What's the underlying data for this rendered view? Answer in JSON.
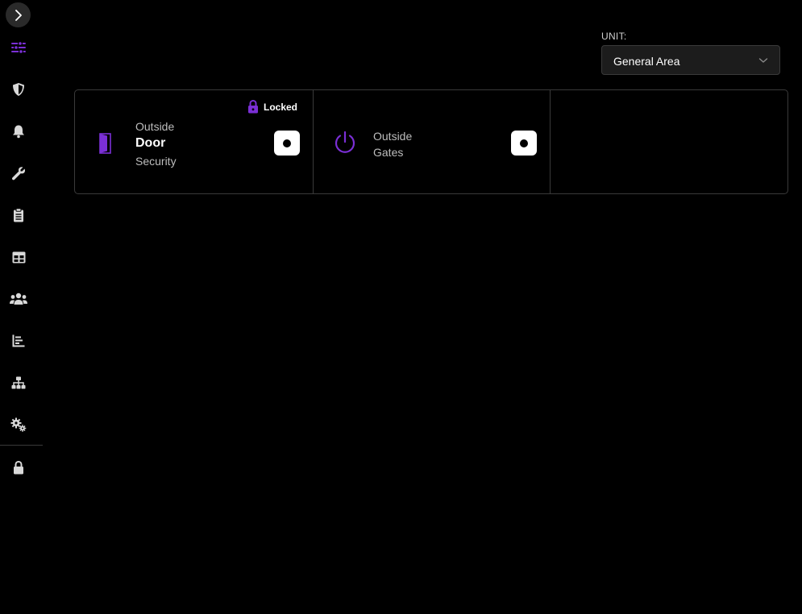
{
  "colors": {
    "accent": "#7b2fd6",
    "background": "#000000",
    "icon": "#d9d9d9",
    "border": "#3a3a3a"
  },
  "sidebar": {
    "expand_icon": "chevron-right-icon",
    "items": [
      {
        "id": "controls",
        "icon": "sliders-icon",
        "active": true
      },
      {
        "id": "security",
        "icon": "shield-icon",
        "active": false
      },
      {
        "id": "alerts",
        "icon": "bell-icon",
        "active": false
      },
      {
        "id": "maintenance",
        "icon": "wrench-icon",
        "active": false
      },
      {
        "id": "clipboard",
        "icon": "clipboard-icon",
        "active": false
      },
      {
        "id": "table",
        "icon": "table-icon",
        "active": false
      },
      {
        "id": "users",
        "icon": "users-icon",
        "active": false
      },
      {
        "id": "reports",
        "icon": "bar-chart-icon",
        "active": false
      },
      {
        "id": "network",
        "icon": "network-icon",
        "active": false
      },
      {
        "id": "settings",
        "icon": "gears-icon",
        "active": false
      },
      {
        "id": "lock",
        "icon": "lock-icon",
        "active": false
      }
    ]
  },
  "unit": {
    "label": "UNIT:",
    "selected": "General Area"
  },
  "cards": [
    {
      "icon": "door-icon",
      "lines": [
        "Outside",
        "Door",
        "Security"
      ],
      "status": "Locked",
      "status_icon": "lock-icon",
      "toggle_on": true
    },
    {
      "icon": "power-icon",
      "lines": [
        "Outside",
        "Gates"
      ],
      "toggle_on": true
    }
  ]
}
